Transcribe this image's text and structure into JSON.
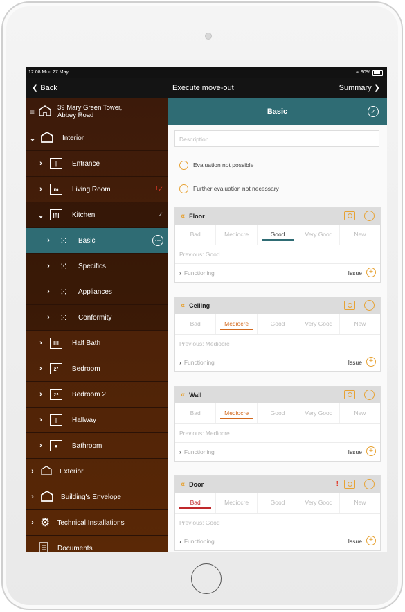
{
  "status": {
    "time": "12:08  Mon 27 May",
    "battery": "90%"
  },
  "nav": {
    "back": "Back",
    "title": "Execute move-out",
    "summary": "Summary"
  },
  "sidebar": {
    "address": "39 Mary Green Tower,\nAbbey Road",
    "items": [
      {
        "label": "Interior"
      },
      {
        "label": "Entrance",
        "icon": "||"
      },
      {
        "label": "Living Room",
        "icon": "m",
        "mark": "!✓"
      },
      {
        "label": "Kitchen",
        "icon": "|†|",
        "mark": "✓"
      },
      {
        "label": "Basic"
      },
      {
        "label": "Specifics"
      },
      {
        "label": "Appliances"
      },
      {
        "label": "Conformity"
      },
      {
        "label": "Half Bath",
        "icon": "ǁǁ"
      },
      {
        "label": "Bedroom",
        "icon": "zᶻ"
      },
      {
        "label": "Bedroom 2",
        "icon": "zᶻ"
      },
      {
        "label": "Hallway",
        "icon": "||"
      },
      {
        "label": "Bathroom",
        "icon": "●"
      },
      {
        "label": "Exterior"
      },
      {
        "label": "Building's Envelope"
      },
      {
        "label": "Technical Installations"
      },
      {
        "label": "Documents"
      }
    ]
  },
  "main": {
    "title": "Basic",
    "description_placeholder": "Description",
    "opt1": "Evaluation not possible",
    "opt2": "Further evaluation not necessary",
    "ratings": [
      "Bad",
      "Mediocre",
      "Good",
      "Very Good",
      "New"
    ],
    "functioning": "Functioning",
    "issue": "Issue",
    "cards": [
      {
        "title": "Floor",
        "previous": "Previous: Good"
      },
      {
        "title": "Ceiling",
        "previous": "Previous: Mediocre"
      },
      {
        "title": "Wall",
        "previous": "Previous: Mediocre"
      },
      {
        "title": "Door",
        "previous": "Previous: Good",
        "alert": "!"
      }
    ]
  },
  "colors": {
    "teal": "#2f6c74",
    "accent": "#e7a233",
    "sidebar": "#4b2108"
  }
}
